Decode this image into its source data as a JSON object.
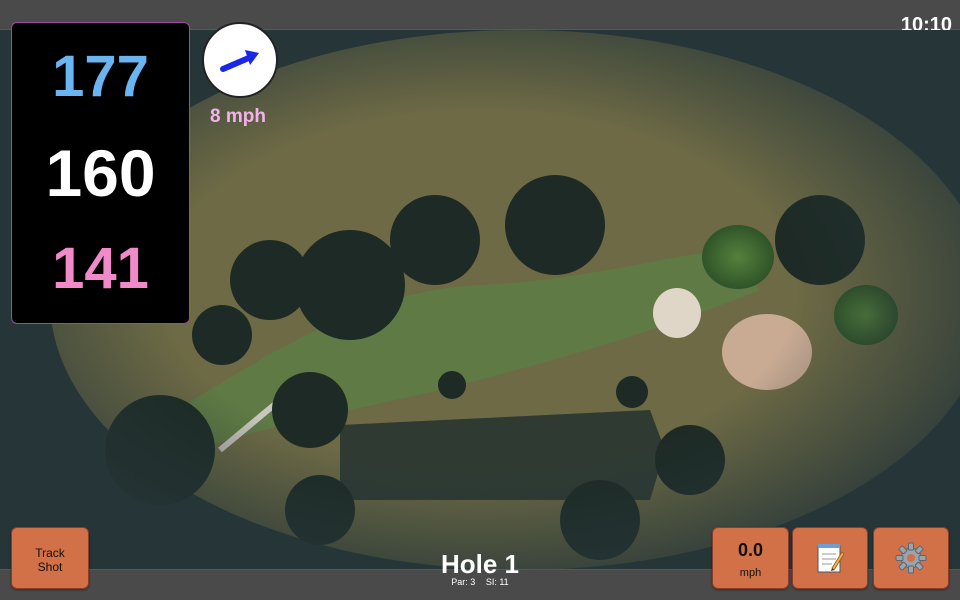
{
  "status_bar": {
    "time": "10:10"
  },
  "distances": {
    "back": "177",
    "middle": "160",
    "front": "141"
  },
  "wind": {
    "speed": "8 mph",
    "arrow_icon": "wind-direction-arrow"
  },
  "buttons": {
    "track_shot": [
      "Track",
      "Shot"
    ],
    "speed": {
      "value": "0.0",
      "unit": "mph"
    },
    "notes_icon": "notepad-icon",
    "settings_icon": "gear-icon"
  },
  "hole": {
    "title": "Hole 1",
    "par": "Par: 3",
    "si": "SI: 11"
  },
  "colors": {
    "back_distance": "#6bb4f2",
    "middle_distance": "#ffffff",
    "front_distance": "#f08ac8",
    "button": "#d27047",
    "accent_border": "#9b4ca0"
  }
}
